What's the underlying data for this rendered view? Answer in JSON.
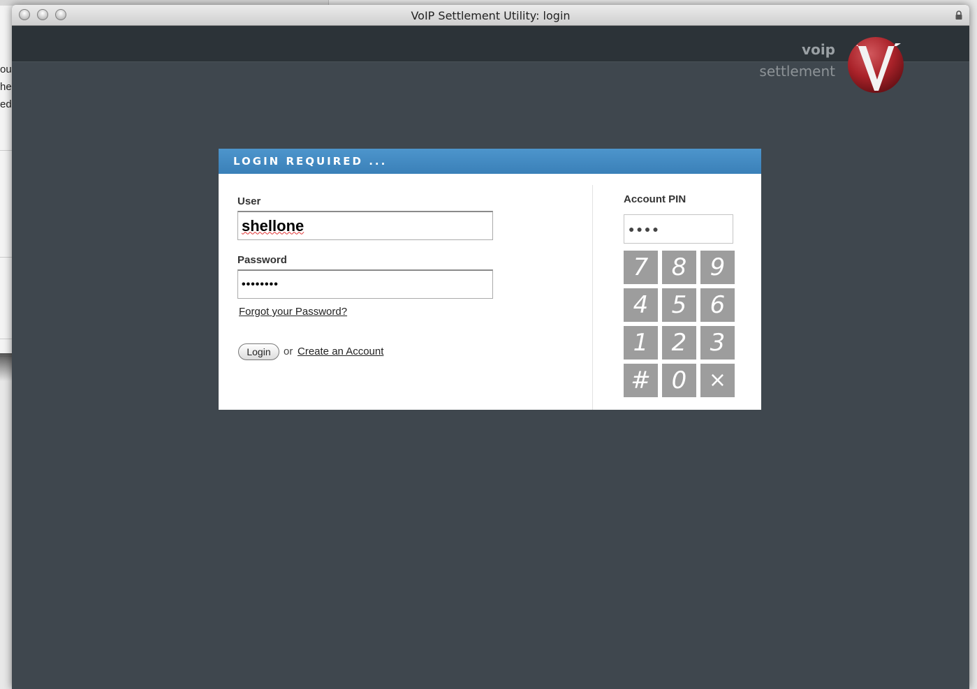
{
  "background_window": {
    "text_lines": [
      "ou",
      "he",
      "ed."
    ]
  },
  "window": {
    "title": "VoIP Settlement Utility: login"
  },
  "brand": {
    "line1": "voip",
    "line2": "settlement",
    "logo_letter": "V"
  },
  "login": {
    "header": "LOGIN REQUIRED ...",
    "user_label": "User",
    "user_value": "shellone",
    "password_label": "Password",
    "password_value": "••••••••",
    "forgot_link": "Forgot your Password?",
    "login_button": "Login",
    "or_text": "or",
    "create_account_link": "Create an Account"
  },
  "pin": {
    "label": "Account PIN",
    "display": "●●●●",
    "keys": [
      [
        "7",
        "8",
        "9"
      ],
      [
        "4",
        "5",
        "6"
      ],
      [
        "1",
        "2",
        "3"
      ],
      [
        "#",
        "0",
        "×"
      ]
    ]
  },
  "colors": {
    "app_background": "#3f474e",
    "header_bar": "#2c3338",
    "panel_header": "#3f88c2",
    "key_background": "#9d9d9d",
    "logo_red": "#b3282e"
  }
}
